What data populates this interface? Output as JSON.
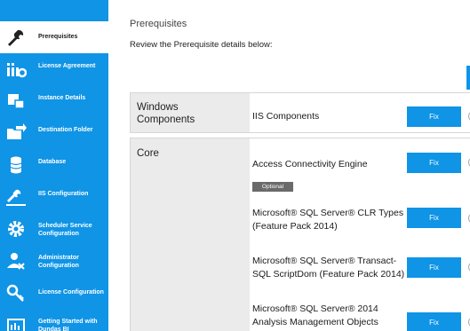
{
  "sidebar": {
    "items": [
      {
        "label": "Prerequisites",
        "icon": "tools-icon",
        "active": true
      },
      {
        "label": "License Agreement",
        "icon": "license-agreement-icon",
        "active": false
      },
      {
        "label": "Instance Details",
        "icon": "instance-details-icon",
        "active": false
      },
      {
        "label": "Destination Folder",
        "icon": "destination-folder-icon",
        "active": false
      },
      {
        "label": "Database",
        "icon": "database-icon",
        "active": false
      },
      {
        "label": "IIS Configuration",
        "icon": "iis-configuration-icon",
        "active": false
      },
      {
        "label": "Scheduler Service Configuration",
        "icon": "scheduler-gear-icon",
        "active": false
      },
      {
        "label": "Administrator Configuration",
        "icon": "administrator-icon",
        "active": false
      },
      {
        "label": "License Configuration",
        "icon": "key-icon",
        "active": false
      },
      {
        "label": "Getting Started with Dundas BI",
        "icon": "getting-started-icon",
        "active": false
      }
    ]
  },
  "main": {
    "title": "Prerequisites",
    "subtitle": "Review the Prerequisite details below:",
    "sections": [
      {
        "title": "Windows Components",
        "items": [
          {
            "label": "IIS Components",
            "button": "Fix"
          }
        ]
      },
      {
        "title": "Core",
        "items": [
          {
            "label": "Access Connectivity Engine",
            "button": "Fix",
            "badge": "Optional"
          },
          {
            "label": "Microsoft® SQL Server® CLR Types (Feature Pack 2014)",
            "button": "Fix"
          },
          {
            "label": "Microsoft® SQL Server® Transact-SQL ScriptDom (Feature Pack 2014)",
            "button": "Fix"
          },
          {
            "label": "Microsoft® SQL Server® 2014 Analysis Management Objects",
            "button": "Fix"
          }
        ]
      }
    ]
  },
  "colors": {
    "accent": "#0f94e6",
    "section_header_bg": "#ebebeb",
    "badge_bg": "#6a6a6a"
  }
}
